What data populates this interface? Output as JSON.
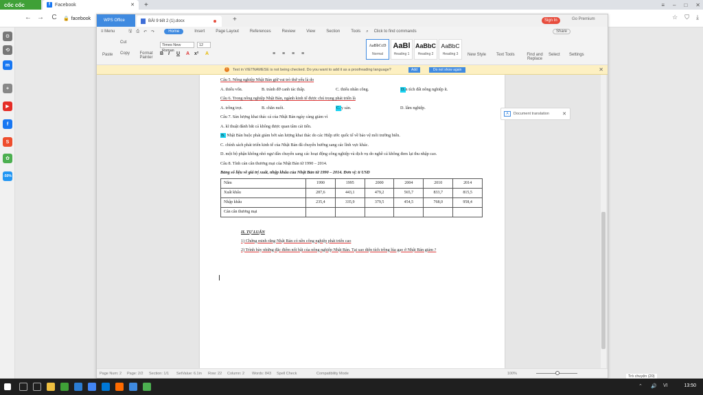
{
  "browser": {
    "coccoc_tab": "cốc cốc",
    "active_tab": "Facebook",
    "address": "facebook",
    "new_tab": "+",
    "back": "←",
    "forward": "→",
    "reload": "C"
  },
  "wps": {
    "logo_label": "WPS Office",
    "doc_tab": "BÀI 9 tiết 2 (1).docx",
    "sign_in": "Sign In",
    "go_premium": "Go Premium",
    "menu_label": "≡ Menu",
    "ribbon_tabs": [
      "Home",
      "Insert",
      "Page Layout",
      "References",
      "Review",
      "View",
      "Section",
      "Tools"
    ],
    "find_commands": "Click to find commands",
    "share": "Share",
    "ribbon": {
      "cut": "Cut",
      "copy": "Copy",
      "paste": "Paste",
      "format_painter": "Format Painter",
      "font": "Times New Roman",
      "size": "12",
      "styles": [
        {
          "preview": "AaBbCcD",
          "label": "Normal"
        },
        {
          "preview": "AaBl",
          "label": "Heading 1"
        },
        {
          "preview": "AaBbC",
          "label": "Heading 2"
        },
        {
          "preview": "AaBbC",
          "label": "Heading 3"
        }
      ],
      "new_style": "New Style",
      "text_tools": "Text Tools",
      "find_replace": "Find and Replace",
      "select": "Select",
      "settings": "Settings"
    },
    "spellcheck": {
      "message": "Text in VIETNAMESE is not being checked. Do you want to add it as a proofreading language?",
      "add": "Add",
      "no_show": "Do not show again"
    },
    "doc_translation": "Document translation",
    "status": {
      "page_num": "Page Num: 2",
      "page": "Page: 2/2",
      "section": "Section: 1/1",
      "set_value": "SetValue: 6.1in",
      "row": "Row: 22",
      "column": "Column: 2",
      "words": "Words: 843",
      "spell_check": "Spell Check",
      "compat": "Compatibility Mode",
      "zoom": "100%"
    }
  },
  "doc": {
    "q5": {
      "question": "Câu 5. Nông nghiệp Nhật Bản giữ vai trò thứ yếu là do",
      "options": [
        "A. thiếu vốn.",
        "B. tránh đỡ canh tác thấp.",
        "C. thiếu nhân công.",
        "D. diện tích đất nông nghiệp ít."
      ],
      "answer_letter": "D."
    },
    "q6": {
      "question": "Câu 6. Trong nông nghiệp Nhật Bản, ngành kinh tế được chú trọng phát triển là",
      "options": [
        "A. trồng trọt.",
        "B. chăn nuôi.",
        "C. thủy sản.",
        "D. lâm nghiệp."
      ],
      "answer_letter": "C."
    },
    "q7": {
      "question": "Câu 7. Sản lượng khai thác cá của Nhật Bản ngày càng giảm vì",
      "a": "A. kĩ thuật đánh bắt cá không được quan tâm cải tiến.",
      "b_letter": "B.",
      "b": " Nhật Bản buộc phải giảm bớt sản lượng khai thác do các Hiệp ước quốc tế về bảo vệ môi trường biển.",
      "c": "C. chính sách phát triển kinh tế của Nhật Bản đã chuyển hướng sang các lĩnh vực khác.",
      "d": "D. một bộ phận không nhỏ ngư dân chuyển sang các hoạt động công nghiệp và dịch vụ do nghề cá không đem lại thu nhập cao."
    },
    "q8": {
      "question": "Câu 8. Tính cán cân thương mại của Nhật Bản từ 1990 – 2014.",
      "table_title": "Bảng số liệu về giá trị xuất, nhập khẩu của Nhật Bản từ 1990 – 2014. Đơn vị: tỉ USD",
      "header": [
        "Năm",
        "1990",
        "1995",
        "2000",
        "2004",
        "2010",
        "2014"
      ],
      "rows": [
        [
          "Xuất khẩu",
          "287,6",
          "443,1",
          "479,2",
          "565,7",
          "833,7",
          "815,5"
        ],
        [
          "Nhập khẩu",
          "235,4",
          "335,9",
          "379,5",
          "454,5",
          "768,0",
          "958,4"
        ],
        [
          "Cán cân thương mại",
          "",
          "",
          "",
          "",
          "",
          ""
        ]
      ]
    },
    "essay": {
      "title": "II. TỰ LUẬN",
      "e1": "1) Chứng minh rằng Nhật Bản có nền công nghiệp phát triển cao",
      "e2": "2) Trình bày những đặc điểm nổi bật của nông nghiệp Nhật Bản. Tại sao diện tích trồng lúa gạo ở Nhật Bản giảm ?"
    }
  },
  "tray": {
    "time": "13:50",
    "chat": "Trò chuyện (20)"
  },
  "colors": {
    "highlight": "#19d3f2",
    "wps_blue": "#3f8ae0",
    "coccoc_green": "#3fa037"
  }
}
